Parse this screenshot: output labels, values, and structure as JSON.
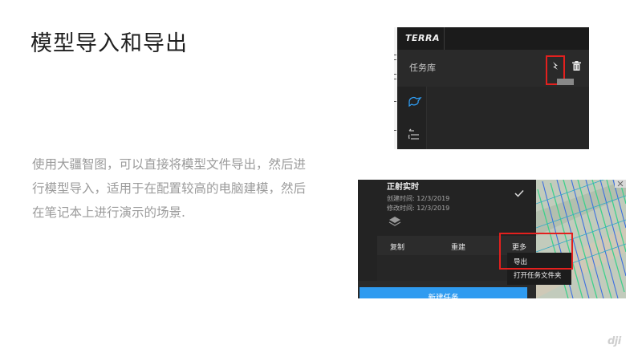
{
  "slide": {
    "title": "模型导入和导出",
    "body": "使用大疆智图，可以直接将模型文件导出，然后进行模型导入，适用于在配置较高的电脑建模，然后在笔记本上进行演示的场景."
  },
  "screenshot_top": {
    "logo": "TERRA",
    "library_label": "任务库",
    "icons": [
      "export-arrow-icon",
      "trash-icon",
      "mission-icon",
      "list-icon"
    ],
    "highlight_color": "#e3201e"
  },
  "screenshot_bottom": {
    "task_title": "正射实时",
    "created": "创建时间: 12/3/2019",
    "modified": "修改时间: 12/3/2019",
    "actions": {
      "copy": "复制",
      "rebuild": "重建",
      "more": "更多"
    },
    "menu": {
      "export": "导出",
      "open_folder": "打开任务文件夹"
    },
    "new_task": "新建任务",
    "accent": "#2f9bf0"
  },
  "brand": "dji"
}
